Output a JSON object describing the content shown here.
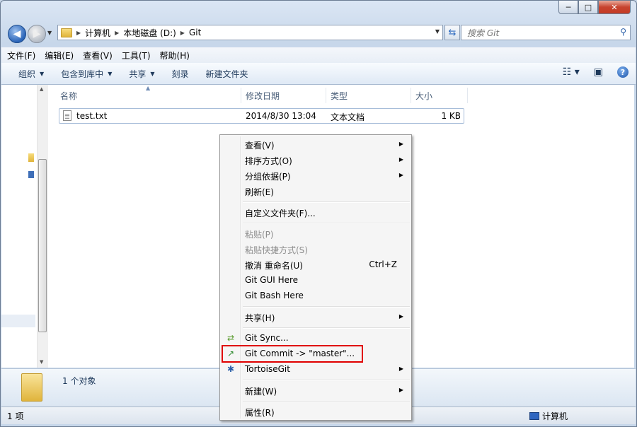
{
  "window": {
    "buttons": [
      "─",
      "□",
      "✕"
    ]
  },
  "address": {
    "breadcrumbs": [
      "计算机",
      "本地磁盘 (D:)",
      "Git"
    ],
    "search_placeholder": "搜索 Git"
  },
  "menubar": [
    "文件(F)",
    "编辑(E)",
    "查看(V)",
    "工具(T)",
    "帮助(H)"
  ],
  "toolbar": {
    "organize": "组织",
    "include_library": "包含到库中",
    "share": "共享",
    "burn": "刻录",
    "new_folder": "新建文件夹"
  },
  "columns": {
    "name": "名称",
    "modified": "修改日期",
    "type": "类型",
    "size": "大小"
  },
  "files": [
    {
      "name": "test.txt",
      "modified": "2014/8/30 13:04",
      "type": "文本文档",
      "size": "1 KB"
    }
  ],
  "details_pane": {
    "count": "1 个对象"
  },
  "statusbar": {
    "items": "1 项",
    "location": "计算机"
  },
  "context_menu": {
    "view": "查看(V)",
    "sort": "排序方式(O)",
    "group": "分组依据(P)",
    "refresh": "刷新(E)",
    "customize": "自定义文件夹(F)...",
    "paste": "粘贴(P)",
    "paste_shortcut": "粘贴快捷方式(S)",
    "undo_rename": "撤消 重命名(U)",
    "undo_shortcut": "Ctrl+Z",
    "git_gui": "Git GUI Here",
    "git_bash": "Git Bash Here",
    "share": "共享(H)",
    "git_sync": "Git Sync...",
    "git_commit": "Git Commit -> \"master\"...",
    "tortoisegit": "TortoiseGit",
    "new": "新建(W)",
    "properties": "属性(R)"
  },
  "icons": {
    "sync": "git-sync-icon",
    "commit": "git-commit-icon",
    "tortoise": "tortoisegit-icon"
  },
  "colors": {
    "highlight_box": "#e00000",
    "accent": "#1e395b"
  }
}
